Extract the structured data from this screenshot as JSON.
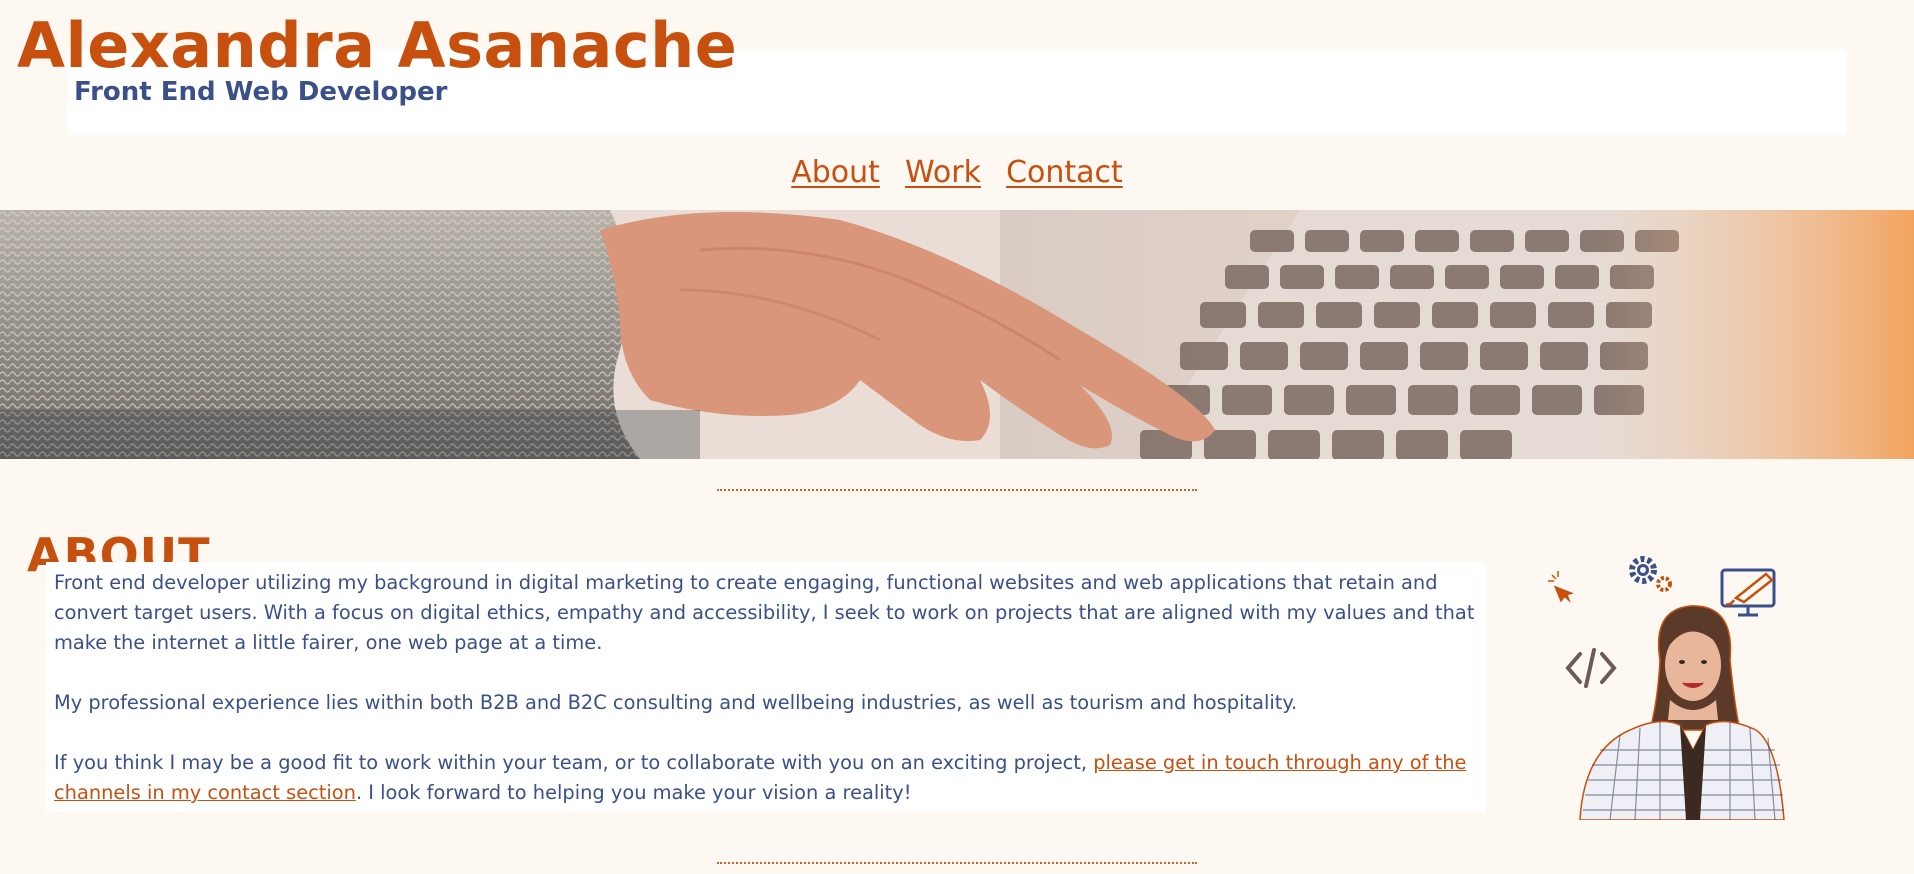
{
  "header": {
    "name": "Alexandra Asanache",
    "subtitle": "Front End Web Developer"
  },
  "nav": {
    "items": [
      {
        "label": "About"
      },
      {
        "label": "Work"
      },
      {
        "label": "Contact"
      }
    ]
  },
  "about": {
    "heading": "ABOUT",
    "paragraph1": "Front end developer utilizing my background in digital marketing to create engaging, functional websites and web applications that retain and convert target users. With a focus on digital ethics, empathy and accessibility, I seek to work on projects that are aligned with my values and that make the internet a little fairer, one web page at a time.",
    "paragraph2": "My professional experience lies within both B2B and B2C consulting and wellbeing industries, as well as tourism and hospitality.",
    "paragraph3_pre": "If you think I may be a good fit to work within your team, or to collaborate with you on an exciting project, ",
    "paragraph3_link": "please get in touch through any of the channels in my contact section",
    "paragraph3_post": ". I look forward to helping you make your vision a reality!"
  },
  "colors": {
    "accent": "#c8500f",
    "text": "#3b5089",
    "background": "#fdf8f1"
  }
}
